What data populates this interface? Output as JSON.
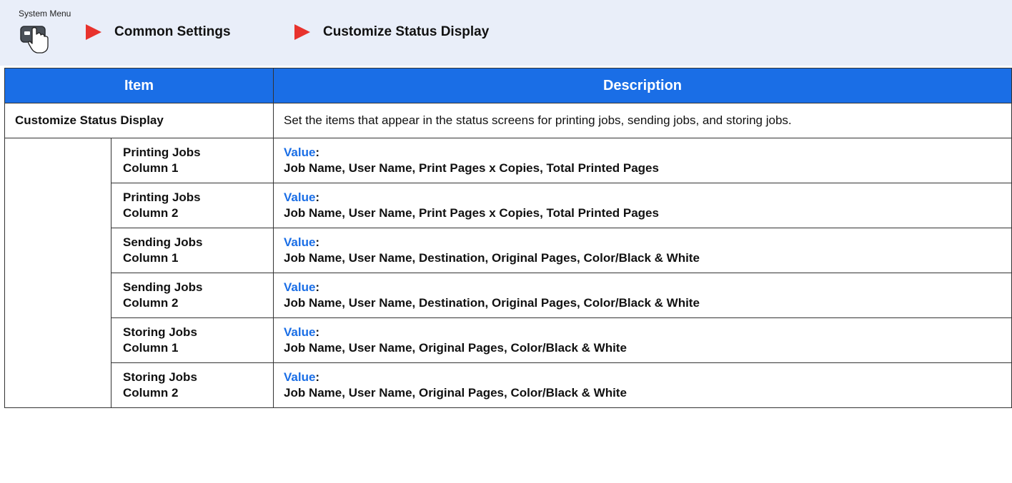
{
  "header": {
    "system_menu_label": "System Menu",
    "breadcrumb": [
      "Common Settings",
      "Customize Status Display"
    ]
  },
  "table": {
    "columns": [
      "Item",
      "Description"
    ],
    "category": {
      "name": "Customize Status Display",
      "description": "Set the items that appear in the status screens for printing jobs, sending jobs, and storing jobs."
    },
    "value_label": "Value",
    "rows": [
      {
        "line1": "Printing Jobs",
        "line2": "Column 1",
        "value": "Job Name, User Name, Print Pages x Copies, Total Printed Pages"
      },
      {
        "line1": "Printing Jobs",
        "line2": "Column 2",
        "value": "Job Name, User Name, Print Pages x Copies, Total Printed Pages"
      },
      {
        "line1": "Sending Jobs",
        "line2": "Column 1",
        "value": "Job Name, User Name, Destination, Original Pages, Color/Black & White"
      },
      {
        "line1": "Sending Jobs",
        "line2": "Column 2",
        "value": "Job Name, User Name, Destination, Original Pages, Color/Black & White"
      },
      {
        "line1": "Storing Jobs",
        "line2": "Column 1",
        "value": "Job Name, User Name, Original Pages, Color/Black & White"
      },
      {
        "line1": "Storing Jobs",
        "line2": "Column 2",
        "value": "Job Name, User Name, Original Pages, Color/Black & White"
      }
    ]
  },
  "colors": {
    "header_bg": "#e9eef9",
    "table_header": "#1a6ee6",
    "arrow": "#e8322d",
    "value_label": "#1a6ee6"
  }
}
